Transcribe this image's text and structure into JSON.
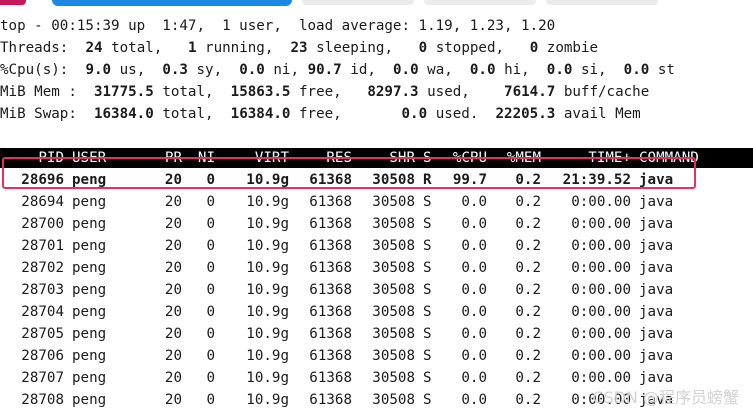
{
  "summary": {
    "line1": "top - 00:15:39 up  1:47,  1 user,  load average: 1.19, 1.23, 1.20",
    "threads": {
      "label": "Threads:",
      "total": "24",
      "total_l": "total,",
      "running": "1",
      "running_l": "running,",
      "sleeping": "23",
      "sleeping_l": "sleeping,",
      "stopped": "0",
      "stopped_l": "stopped,",
      "zombie": "0",
      "zombie_l": "zombie"
    },
    "cpu": {
      "label": "%Cpu(s):",
      "us": "9.0",
      "us_l": "us,",
      "sy": "0.3",
      "sy_l": "sy,",
      "ni": "0.0",
      "ni_l": "ni,",
      "id": "90.7",
      "id_l": "id,",
      "wa": "0.0",
      "wa_l": "wa,",
      "hi": "0.0",
      "hi_l": "hi,",
      "si": "0.0",
      "si_l": "si,",
      "st": "0.0",
      "st_l": "st"
    },
    "mem": {
      "label": "MiB Mem :",
      "total": "31775.5",
      "total_l": "total,",
      "free": "15863.5",
      "free_l": "free,",
      "used": "8297.3",
      "used_l": "used,",
      "buff": "7614.7",
      "buff_l": "buff/cache"
    },
    "swap": {
      "label": "MiB Swap:",
      "total": "16384.0",
      "total_l": "total,",
      "free": "16384.0",
      "free_l": "free,",
      "used": "0.0",
      "used_l": "used.",
      "avail": "22205.3",
      "avail_l": "avail Mem"
    }
  },
  "columns": {
    "pid": "PID",
    "user": "USER",
    "pr": "PR",
    "ni": "NI",
    "virt": "VIRT",
    "res": "RES",
    "shr": "SHR",
    "s": "S",
    "cpu": "%CPU",
    "mem": "%MEM",
    "time": "TIME+",
    "command": "COMMAND"
  },
  "processes": [
    {
      "pid": "28696",
      "user": "peng",
      "pr": "20",
      "ni": "0",
      "virt": "10.9g",
      "res": "61368",
      "shr": "30508",
      "s": "R",
      "cpu": "99.7",
      "mem": "0.2",
      "time": "21:39.52",
      "command": "java"
    },
    {
      "pid": "28694",
      "user": "peng",
      "pr": "20",
      "ni": "0",
      "virt": "10.9g",
      "res": "61368",
      "shr": "30508",
      "s": "S",
      "cpu": "0.0",
      "mem": "0.2",
      "time": "0:00.00",
      "command": "java"
    },
    {
      "pid": "28700",
      "user": "peng",
      "pr": "20",
      "ni": "0",
      "virt": "10.9g",
      "res": "61368",
      "shr": "30508",
      "s": "S",
      "cpu": "0.0",
      "mem": "0.2",
      "time": "0:00.00",
      "command": "java"
    },
    {
      "pid": "28701",
      "user": "peng",
      "pr": "20",
      "ni": "0",
      "virt": "10.9g",
      "res": "61368",
      "shr": "30508",
      "s": "S",
      "cpu": "0.0",
      "mem": "0.2",
      "time": "0:00.00",
      "command": "java"
    },
    {
      "pid": "28702",
      "user": "peng",
      "pr": "20",
      "ni": "0",
      "virt": "10.9g",
      "res": "61368",
      "shr": "30508",
      "s": "S",
      "cpu": "0.0",
      "mem": "0.2",
      "time": "0:00.00",
      "command": "java"
    },
    {
      "pid": "28703",
      "user": "peng",
      "pr": "20",
      "ni": "0",
      "virt": "10.9g",
      "res": "61368",
      "shr": "30508",
      "s": "S",
      "cpu": "0.0",
      "mem": "0.2",
      "time": "0:00.00",
      "command": "java"
    },
    {
      "pid": "28704",
      "user": "peng",
      "pr": "20",
      "ni": "0",
      "virt": "10.9g",
      "res": "61368",
      "shr": "30508",
      "s": "S",
      "cpu": "0.0",
      "mem": "0.2",
      "time": "0:00.00",
      "command": "java"
    },
    {
      "pid": "28705",
      "user": "peng",
      "pr": "20",
      "ni": "0",
      "virt": "10.9g",
      "res": "61368",
      "shr": "30508",
      "s": "S",
      "cpu": "0.0",
      "mem": "0.2",
      "time": "0:00.00",
      "command": "java"
    },
    {
      "pid": "28706",
      "user": "peng",
      "pr": "20",
      "ni": "0",
      "virt": "10.9g",
      "res": "61368",
      "shr": "30508",
      "s": "S",
      "cpu": "0.0",
      "mem": "0.2",
      "time": "0:00.00",
      "command": "java"
    },
    {
      "pid": "28707",
      "user": "peng",
      "pr": "20",
      "ni": "0",
      "virt": "10.9g",
      "res": "61368",
      "shr": "30508",
      "s": "S",
      "cpu": "0.0",
      "mem": "0.2",
      "time": "0:00.00",
      "command": "java"
    },
    {
      "pid": "28708",
      "user": "peng",
      "pr": "20",
      "ni": "0",
      "virt": "10.9g",
      "res": "61368",
      "shr": "30508",
      "s": "S",
      "cpu": "0.0",
      "mem": "0.2",
      "time": "0:00.00",
      "command": "java"
    }
  ],
  "watermark": "CSDN @程序员螃蟹",
  "colors": {
    "highlight": "#e0335f",
    "header_bg": "#000000",
    "tab_accent": "#1e88e5",
    "tab_pink": "#c2185b"
  }
}
